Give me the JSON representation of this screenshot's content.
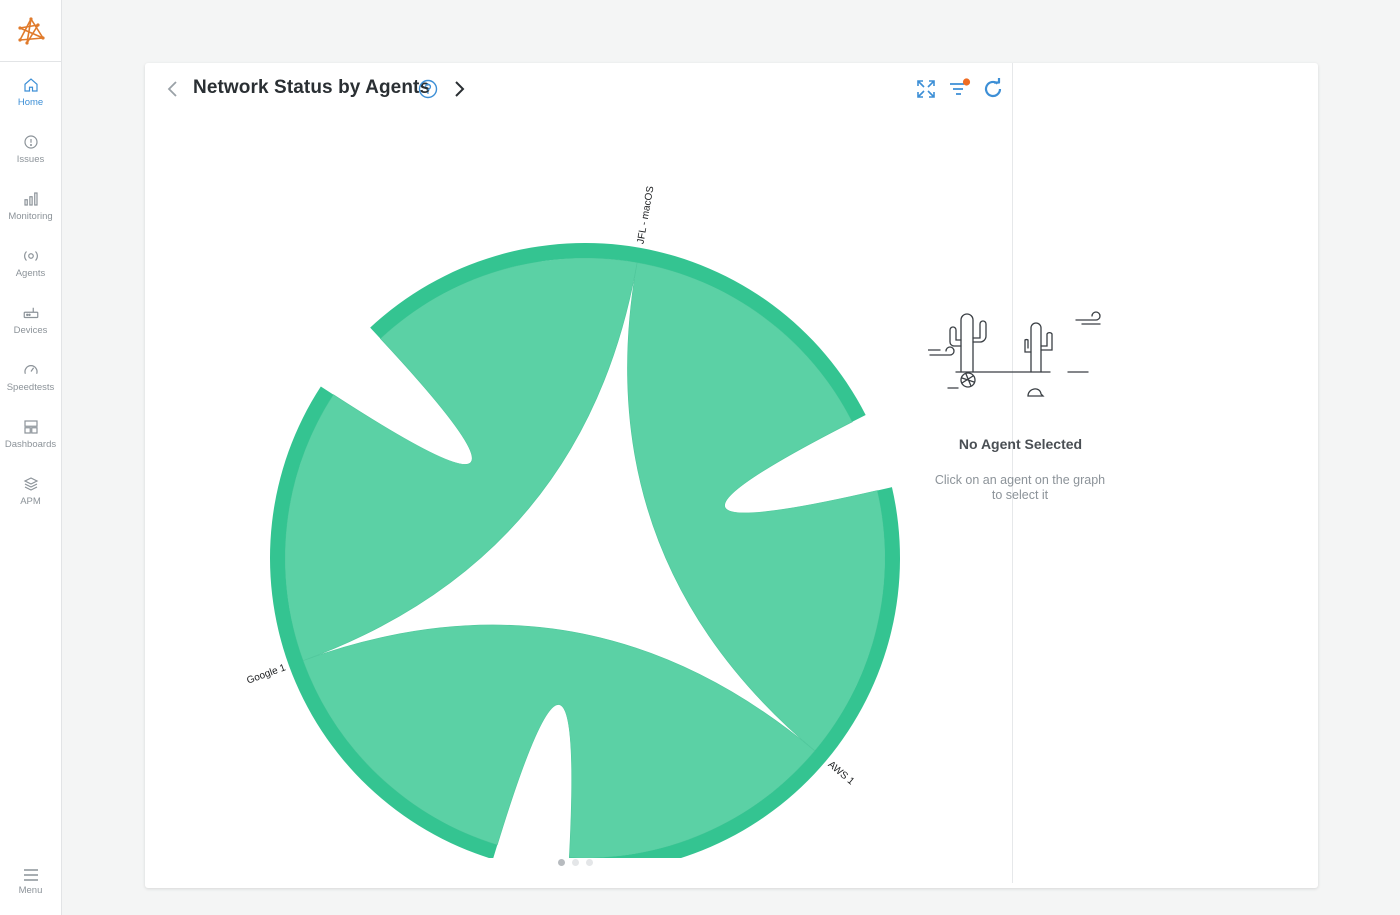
{
  "sidebar": {
    "items": [
      {
        "label": "Home",
        "icon": "home-icon",
        "active": true
      },
      {
        "label": "Issues",
        "icon": "alert-circle-icon",
        "active": false
      },
      {
        "label": "Monitoring",
        "icon": "bar-chart-icon",
        "active": false
      },
      {
        "label": "Agents",
        "icon": "agent-radio-icon",
        "active": false
      },
      {
        "label": "Devices",
        "icon": "router-icon",
        "active": false
      },
      {
        "label": "Speedtests",
        "icon": "speedometer-icon",
        "active": false
      },
      {
        "label": "Dashboards",
        "icon": "dashboard-grid-icon",
        "active": false
      },
      {
        "label": "APM",
        "icon": "layers-icon",
        "active": false
      }
    ],
    "menu_label": "Menu"
  },
  "header": {
    "title": "Network Status by Agents"
  },
  "chart_data": {
    "type": "chord",
    "nodes": [
      "JFL - macOS",
      "AWS 1",
      "Google 1"
    ],
    "links": [
      {
        "source": "JFL - macOS",
        "target": "AWS 1",
        "value": 1
      },
      {
        "source": "AWS 1",
        "target": "Google 1",
        "value": 1
      },
      {
        "source": "Google 1",
        "target": "JFL - macOS",
        "value": 1
      }
    ],
    "colors": {
      "ribbon": "#5bd1a5",
      "arc": "#34c491"
    }
  },
  "pagination": {
    "pages": 3,
    "current": 1
  },
  "right_panel": {
    "title": "No Agent Selected",
    "description": "Click on an agent on the graph to select it"
  },
  "colors": {
    "accent": "#3d8fd6",
    "logo": "#e07a2b",
    "badge": "#ef6c22"
  }
}
